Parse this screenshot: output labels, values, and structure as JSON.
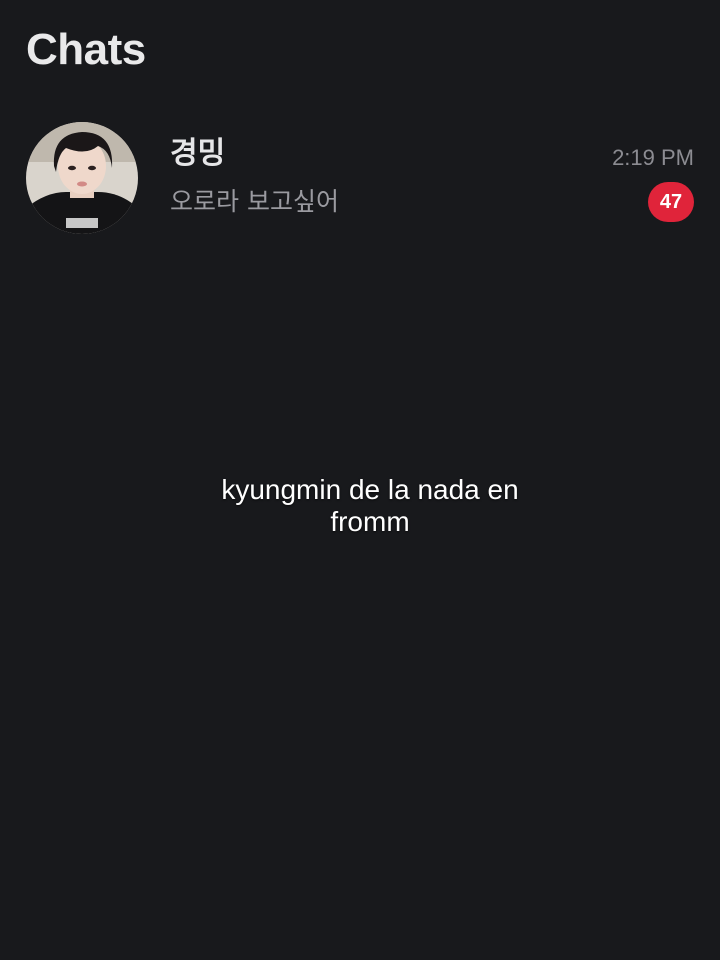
{
  "header": {
    "title": "Chats"
  },
  "chats": [
    {
      "name": "경밍",
      "preview": "오로라 보고싶어",
      "time": "2:19 PM",
      "unread_count": "47",
      "avatar_icon": "profile-photo"
    }
  ],
  "overlay": {
    "caption": "kyungmin de la nada en\nfromm"
  },
  "colors": {
    "background": "#18191c",
    "badge": "#e0243a",
    "title": "#e9e9ea",
    "secondary_text": "#9a9aa0"
  }
}
